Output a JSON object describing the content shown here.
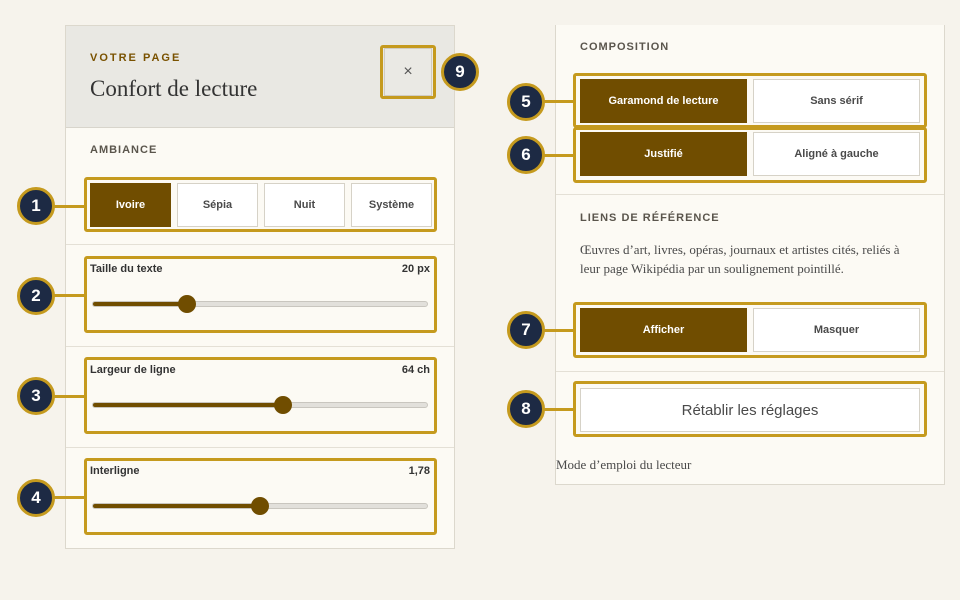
{
  "left": {
    "eyebrow": "VOTRE PAGE",
    "title": "Confort de lecture",
    "close_glyph": "×",
    "ambiance": {
      "label": "AMBIANCE",
      "options": [
        "Ivoire",
        "Sépia",
        "Nuit",
        "Système"
      ],
      "selected": "Ivoire"
    },
    "sliders": [
      {
        "label": "Taille du texte",
        "value": "20 px",
        "fraction": 0.28
      },
      {
        "label": "Largeur de ligne",
        "value": "64 ch",
        "fraction": 0.57
      },
      {
        "label": "Interligne",
        "value": "1,78",
        "fraction": 0.5
      }
    ]
  },
  "right": {
    "composition": {
      "label": "COMPOSITION",
      "font_options": [
        "Garamond de lecture",
        "Sans sérif"
      ],
      "font_selected": "Garamond de lecture",
      "align_options": [
        "Justifié",
        "Aligné à gauche"
      ],
      "align_selected": "Justifié"
    },
    "links": {
      "label": "LIENS DE RÉFÉRENCE",
      "description": "Œuvres d’art, livres, opéras, journaux et artistes cités, reliés à leur page Wikipédia par un soulignement pointillé.",
      "options": [
        "Afficher",
        "Masquer"
      ],
      "selected": "Afficher"
    },
    "reset_label": "Rétablir les réglages",
    "footer_link": "Mode d’emploi du lecteur"
  },
  "callouts": [
    "1",
    "2",
    "3",
    "4",
    "5",
    "6",
    "7",
    "8",
    "9"
  ],
  "colors": {
    "accent": "#704d00",
    "highlight": "#c59a1e",
    "callout_bg": "#1d2a44"
  }
}
